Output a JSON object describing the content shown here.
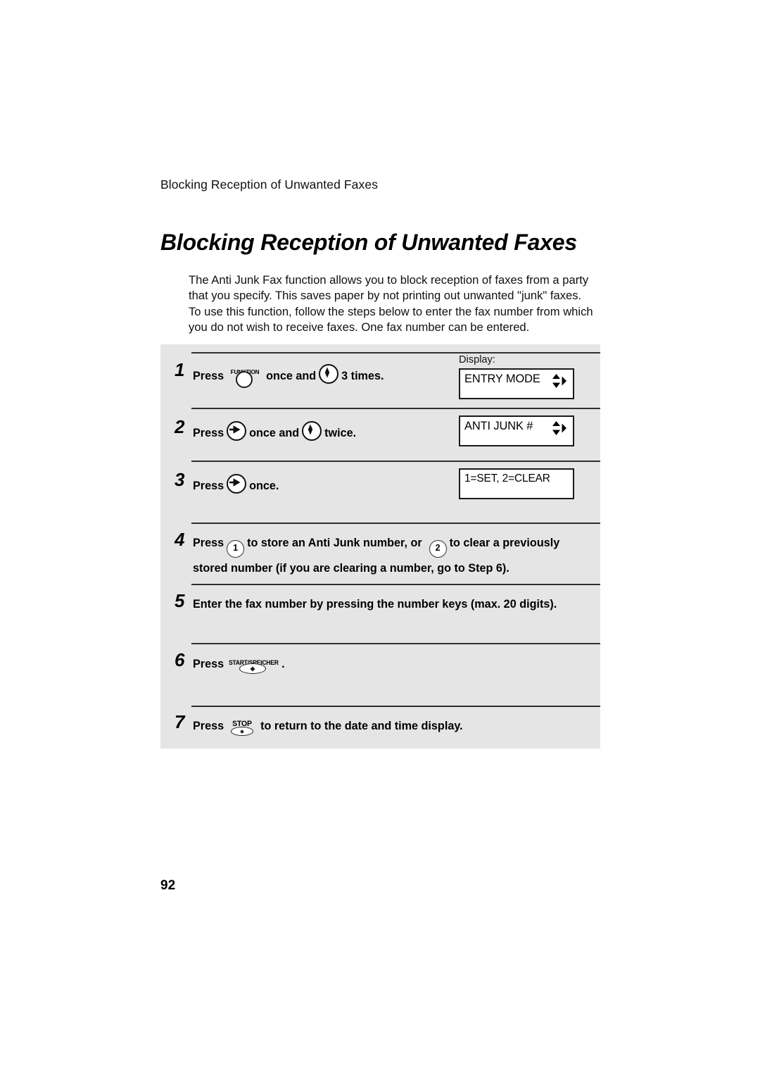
{
  "document": {
    "running_header": "Blocking Reception of Unwanted Faxes",
    "title": "Blocking Reception of Unwanted Faxes",
    "page_number": "92",
    "intro_lines": [
      "The Anti Junk Fax function allows you to block reception of faxes from a party",
      "that you specify. This saves paper by not printing out unwanted \"junk\" faxes.",
      "To use this function, follow the steps below to enter the fax number from which",
      "you do not wish to receive faxes. One fax number can be entered."
    ]
  },
  "display": {
    "caption": "Display:",
    "entry_mode": "ENTRY MODE",
    "anti_junk": "ANTI JUNK #",
    "set_clear": "1=SET, 2=CLEAR"
  },
  "keys": {
    "funktion": "FUNKTION",
    "start_speicher": "START/SPEICHER",
    "stop": "STOP",
    "num_one": "1",
    "num_two": "2"
  },
  "steps": [
    {
      "number": "1",
      "text_a": "Press",
      "text_b": "once and",
      "text_c": "3 times."
    },
    {
      "number": "2",
      "text_a": "Press",
      "text_b": "once and",
      "text_c": "twice."
    },
    {
      "number": "3",
      "text_a": "Press",
      "text_b": "once."
    },
    {
      "number": "4",
      "text_a": "Press",
      "text_b": "to store an Anti Junk number, or",
      "text_c": "to clear a previously",
      "text_d": "stored number (if you are clearing a number, go to Step 6)."
    },
    {
      "number": "5",
      "text_a": "Enter the fax number by pressing the number keys (max. 20 digits)."
    },
    {
      "number": "6",
      "text_a": "Press",
      "text_b": "."
    },
    {
      "number": "7",
      "text_a": "Press",
      "text_b": "to return to the date and time display."
    }
  ],
  "colors": {
    "panel_background": "#e5e5e5",
    "page_background": "#ffffff",
    "rule": "#2f2f2f",
    "ink": "#000000"
  }
}
